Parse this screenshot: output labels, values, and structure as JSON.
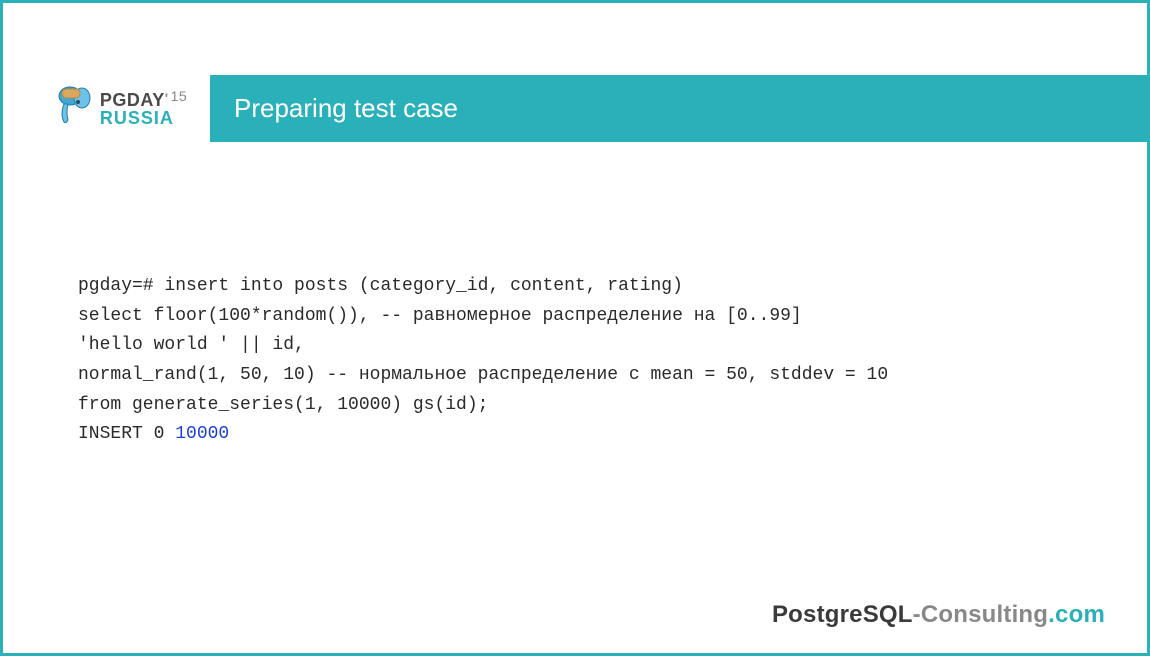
{
  "logo": {
    "line1_main": "PGDAY",
    "line1_apos": "'",
    "line1_year": "15",
    "line2": "RUSSIA"
  },
  "title": "Preparing test case",
  "code": {
    "l1": "pgday=# insert into posts (category_id, content, rating)",
    "l2": "select floor(100*random()), -- равномерное распределение на [0..99]",
    "l3": "'hello world ' || id,",
    "l4": "normal_rand(1, 50, 10) -- нормальное распределение с mean = 50, stddev = 10",
    "l5": "from generate_series(1, 10000) gs(id);",
    "l6a": "INSERT 0 ",
    "l6b": "10000"
  },
  "footer": {
    "p1": "Postgre",
    "p2": "SQL",
    "p3": "-Consulting",
    "p4": ".com"
  }
}
